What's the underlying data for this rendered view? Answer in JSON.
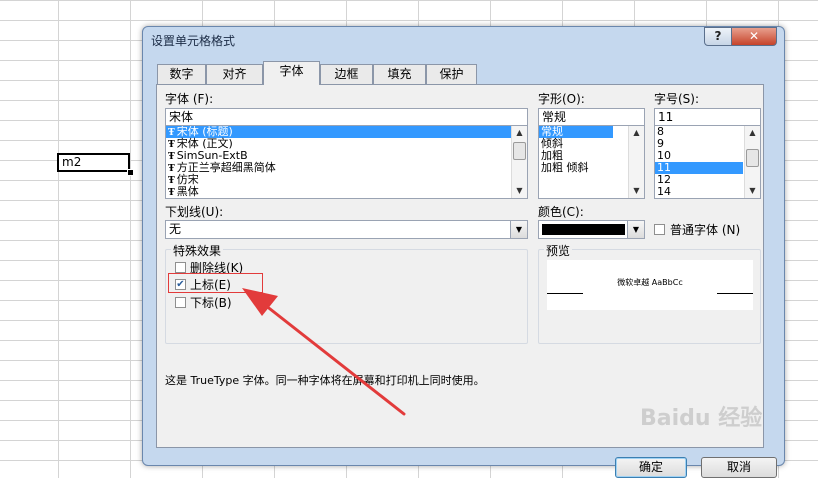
{
  "sheet": {
    "cell_value": "m2"
  },
  "dialog": {
    "title": "设置单元格格式",
    "help_label": "?",
    "close_label": "✕",
    "tabs": [
      {
        "label": "数字"
      },
      {
        "label": "对齐"
      },
      {
        "label": "字体"
      },
      {
        "label": "边框"
      },
      {
        "label": "填充"
      },
      {
        "label": "保护"
      }
    ],
    "active_tab": "字体",
    "font": {
      "label": "字体 (F):",
      "value": "宋体",
      "items": [
        "宋体 (标题)",
        "宋体 (正文)",
        "SimSun-ExtB",
        "方正兰亭超细黑简体",
        "仿宋",
        "黑体"
      ],
      "selected_index": 0
    },
    "style": {
      "label": "字形(O):",
      "value": "常规",
      "items": [
        "常规",
        "倾斜",
        "加粗",
        "加粗 倾斜"
      ],
      "selected_index": 0
    },
    "size": {
      "label": "字号(S):",
      "value": "11",
      "items": [
        "8",
        "9",
        "10",
        "11",
        "12",
        "14"
      ],
      "selected_index": 3
    },
    "underline": {
      "label": "下划线(U):",
      "value": "无"
    },
    "color": {
      "label": "颜色(C):",
      "value_hex": "#000000"
    },
    "normal_font": {
      "label": "普通字体 (N)",
      "checked": false
    },
    "effects": {
      "title": "特殊效果",
      "strikethrough": {
        "label": "删除线(K)",
        "checked": false
      },
      "superscript": {
        "label": "上标(E)",
        "checked": true
      },
      "subscript": {
        "label": "下标(B)",
        "checked": false
      }
    },
    "preview": {
      "title": "预览",
      "sample": "微软卓越 AaBbCc"
    },
    "info_text": "这是 TrueType 字体。同一种字体将在屏幕和打印机上同时使用。",
    "ok_label": "确定",
    "cancel_label": "取消"
  },
  "watermark": {
    "text": "Baidu 经验"
  },
  "colors": {
    "annotation": "#e23b3b",
    "selection": "#3399ff"
  }
}
